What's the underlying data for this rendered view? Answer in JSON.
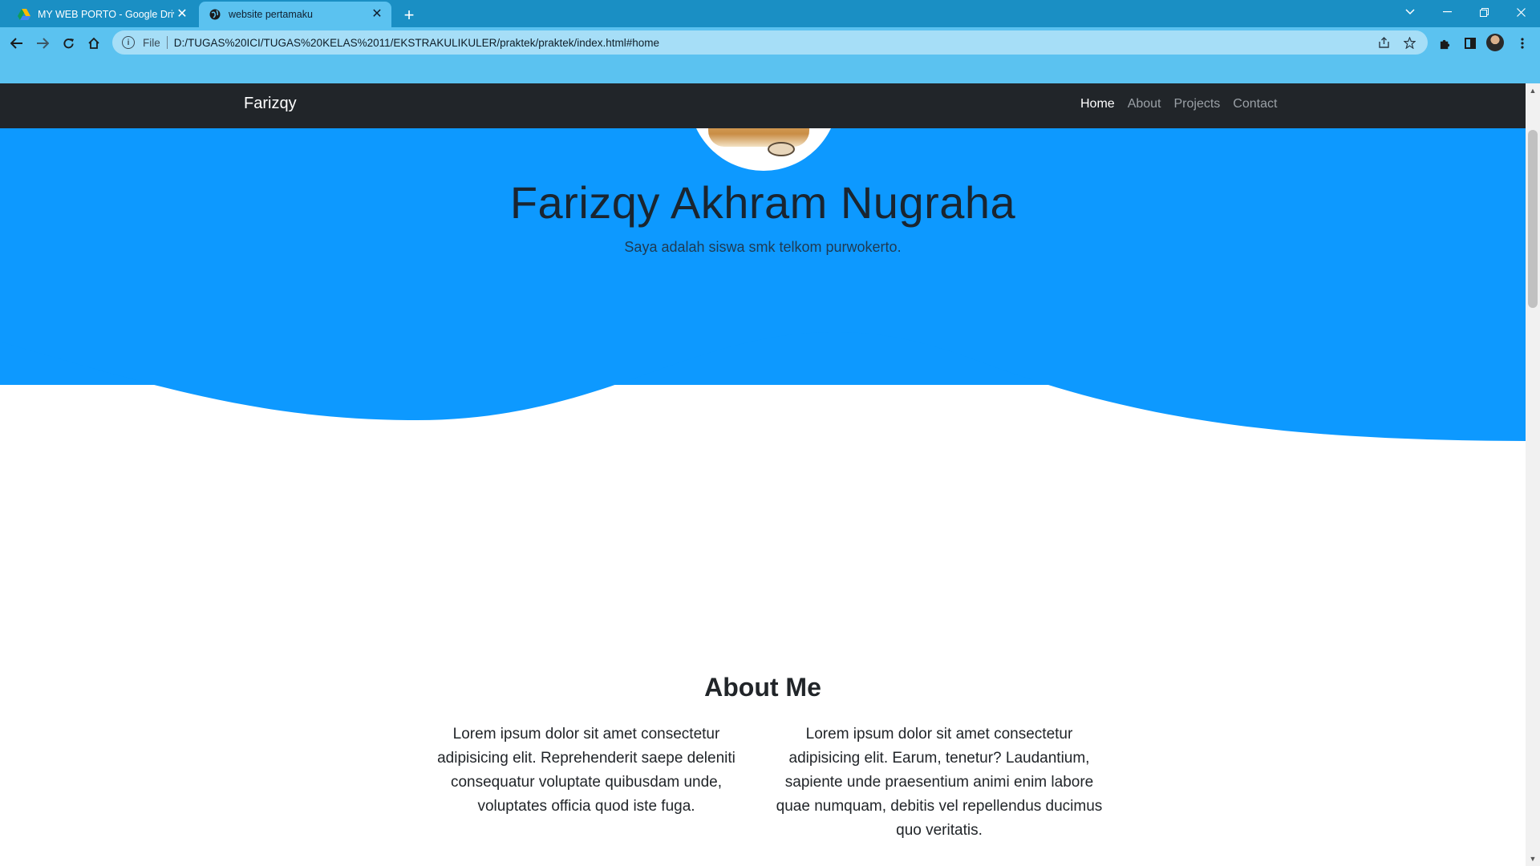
{
  "browser": {
    "tabs": [
      {
        "title": "MY WEB PORTO - Google Drive",
        "icon": "google-drive-icon",
        "active": false
      },
      {
        "title": "website pertamaku",
        "icon": "globe-icon",
        "active": true
      }
    ],
    "new_tab_label": "+",
    "address_bar": {
      "scheme_label": "File",
      "url": "D:/TUGAS%20ICI/TUGAS%20KELAS%2011/EKSTRAKULIKULER/praktek/praktek/index.html#home"
    },
    "colors": {
      "tabbar": "#1a8fc4",
      "toolbar": "#5bc2f0",
      "omnibox": "#a6def7"
    }
  },
  "site": {
    "brand": "Farizqy",
    "nav": [
      {
        "label": "Home",
        "active": true
      },
      {
        "label": "About",
        "active": false
      },
      {
        "label": "Projects",
        "active": false
      },
      {
        "label": "Contact",
        "active": false
      }
    ],
    "hero": {
      "title": "Farizqy Akhram Nugraha",
      "subtitle": "Saya adalah siswa smk telkom purwokerto.",
      "background": "#0d99ff"
    },
    "about": {
      "heading": "About Me",
      "paragraphs": [
        "Lorem ipsum dolor sit amet consectetur adipisicing elit. Reprehenderit saepe deleniti consequatur voluptate quibusdam unde, voluptates officia quod iste fuga.",
        "Lorem ipsum dolor sit amet consectetur adipisicing elit. Earum, tenetur? Laudantium, sapiente unde praesentium animi enim labore quae numquam, debitis vel repellendus ducimus quo veritatis."
      ]
    },
    "colors": {
      "navbar": "#212529",
      "wave": "#0d99ff"
    }
  }
}
